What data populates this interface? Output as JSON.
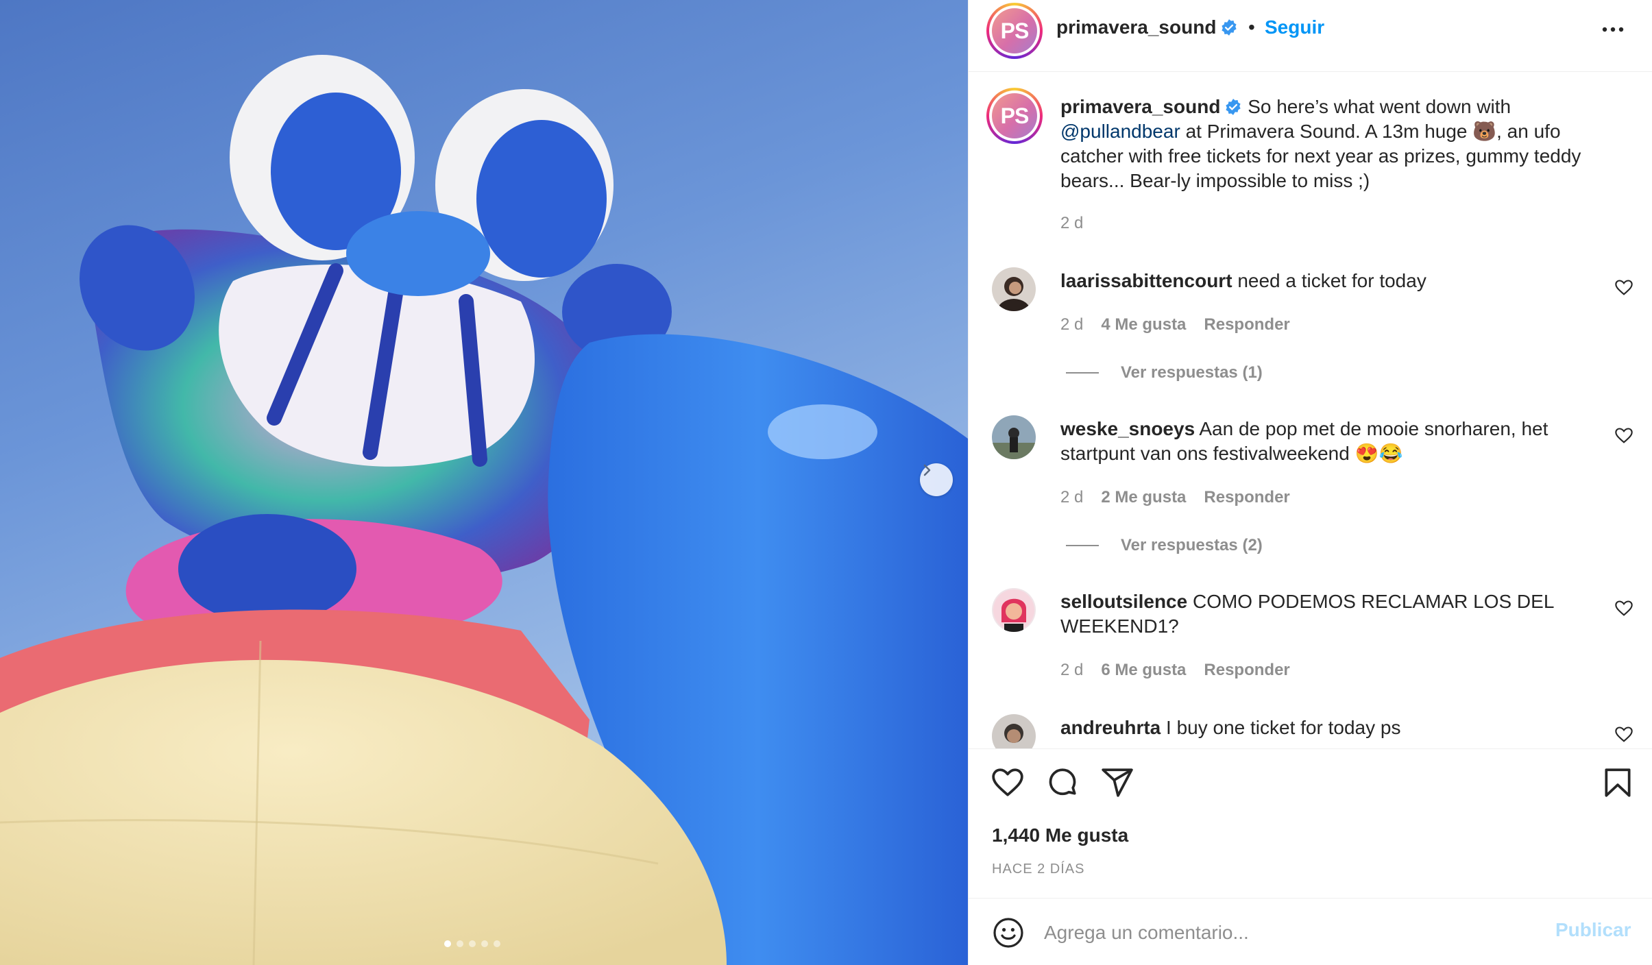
{
  "header": {
    "avatar_text": "PS",
    "username": "primavera_sound",
    "separator": "•",
    "follow_label": "Seguir"
  },
  "caption": {
    "avatar_text": "PS",
    "username": "primavera_sound",
    "text_before_mention": "So here’s what went down with",
    "mention": "@pullandbear",
    "text_after_mention": "at Primavera Sound. A 13m huge 🐻,  an ufo catcher with free tickets for next year as prizes, gummy teddy bears... Bear-ly impossible to miss ;)",
    "time": "2 d"
  },
  "comments": [
    {
      "username": "laarissabittencourt",
      "text": "need a ticket for today",
      "time": "2 d",
      "likes": "4 Me gusta",
      "reply": "Responder",
      "view_replies": "Ver respuestas (1)"
    },
    {
      "username": "weske_snoeys",
      "text": "Aan de pop met de mooie snorharen, het startpunt van ons festivalweekend 😍😂",
      "time": "2 d",
      "likes": "2 Me gusta",
      "reply": "Responder",
      "view_replies": "Ver respuestas (2)"
    },
    {
      "username": "selloutsilence",
      "text": "COMO PODEMOS RECLAMAR LOS DEL WEEKEND1?",
      "time": "2 d",
      "likes": "6 Me gusta",
      "reply": "Responder"
    },
    {
      "username": "andreuhrta",
      "text": "I buy one ticket for today ps"
    }
  ],
  "actions": {
    "likes": "1,440 Me gusta",
    "date": "HACE 2 DÍAS"
  },
  "add_comment": {
    "placeholder": "Agrega un comentario...",
    "post_label": "Publicar"
  },
  "carousel": {
    "total": 5,
    "active": 1
  },
  "colors": {
    "accent": "#0095f6",
    "text": "#262626",
    "muted": "#8e8e8e",
    "post_disabled": "#b2dffc"
  }
}
